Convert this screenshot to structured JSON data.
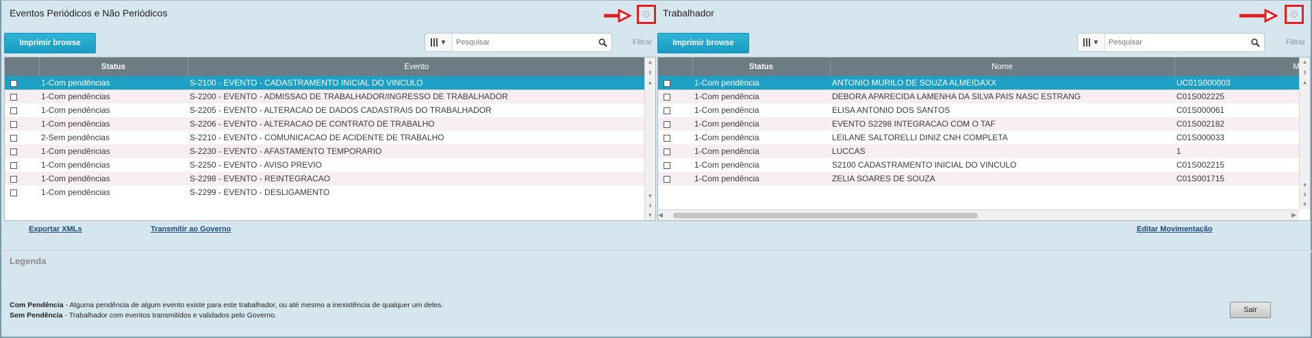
{
  "left_panel": {
    "title": "Eventos Periódicos e Não Periódicos",
    "print_button": "Imprimir browse",
    "search_placeholder": "Pesquisar",
    "filter_label": "Filtrar",
    "columns": [
      "",
      "Status",
      "Evento"
    ],
    "rows": [
      {
        "status": "1-Com pendências",
        "evento": "S-2100 - EVENTO - CADASTRAMENTO INICIAL DO VINCULO"
      },
      {
        "status": "1-Com pendências",
        "evento": "S-2200 - EVENTO - ADMISSAO DE TRABALHADOR/INGRESSO DE TRABALHADOR"
      },
      {
        "status": "1-Com pendências",
        "evento": "S-2205 - EVENTO - ALTERACAO DE DADOS CADASTRAIS DO TRABALHADOR"
      },
      {
        "status": "1-Com pendências",
        "evento": "S-2206 - EVENTO - ALTERACAO DE CONTRATO DE TRABALHO"
      },
      {
        "status": "2-Sem pendências",
        "evento": "S-2210 - EVENTO - COMUNICACAO DE ACIDENTE DE TRABALHO"
      },
      {
        "status": "1-Com pendências",
        "evento": "S-2230 - EVENTO - AFASTAMENTO TEMPORARIO"
      },
      {
        "status": "1-Com pendências",
        "evento": "S-2250 - EVENTO - AVISO PREVIO"
      },
      {
        "status": "1-Com pendências",
        "evento": "S-2298 - EVENTO - REINTEGRACAO"
      },
      {
        "status": "1-Com pendências",
        "evento": "S-2299 - EVENTO - DESLIGAMENTO"
      }
    ],
    "links": {
      "export": "Exportar XMLs",
      "transmit": "Transmitir ao Governo"
    }
  },
  "right_panel": {
    "title": "Trabalhador",
    "print_button": "Imprimir browse",
    "search_placeholder": "Pesquisar",
    "filter_label": "Filtrar",
    "columns": [
      "",
      "Status",
      "Nome",
      "M"
    ],
    "rows": [
      {
        "status": "1-Com pendência",
        "nome": "ANTONIO MURILO DE SOUZA ALMEIDAXX",
        "mat": "UC01S000003"
      },
      {
        "status": "1-Com pendência",
        "nome": "DEBORA APARECIDA LAMENHA DA SILVA PAIS NASC ESTRANG",
        "mat": "C01S002225"
      },
      {
        "status": "1-Com pendência",
        "nome": "ELISA ANTONIO DOS SANTOS",
        "mat": "C01S000061"
      },
      {
        "status": "1-Com pendência",
        "nome": "EVENTO S2298 INTEGRACAO COM O TAF",
        "mat": "C01S002182"
      },
      {
        "status": "1-Com pendência",
        "nome": "LEILANE SALTORELLI DINIZ CNH COMPLETA",
        "mat": "C01S000033"
      },
      {
        "status": "1-Com pendência",
        "nome": "LUCCAS",
        "mat": "1"
      },
      {
        "status": "1-Com pendência",
        "nome": "S2100 CADASTRAMENTO INICIAL DO VINCULO",
        "mat": "C01S002215"
      },
      {
        "status": "1-Com pendência",
        "nome": "ZELIA SOARES DE SOUZA",
        "mat": "C01S001715"
      }
    ],
    "links": {
      "edit": "Editar Movimentação"
    }
  },
  "legend": {
    "title": "Legenda",
    "com_label": "Com Pendência",
    "com_text": " - Alguma pendência de algum evento existe para este trabalhador, ou até mesmo a inexistência de qualquer um deles.",
    "sem_label": "Sem Pendência",
    "sem_text": " - Trabalhador com eventos transmitidos e validados pelo Governo."
  },
  "exit_button": "Sair",
  "icons": [
    "gear-icon",
    "search-icon",
    "columns-icon",
    "red-arrow-annotation"
  ],
  "colors": {
    "accent": "#1e9fc6",
    "header": "#6d7b83",
    "annotation": "#e02020"
  }
}
